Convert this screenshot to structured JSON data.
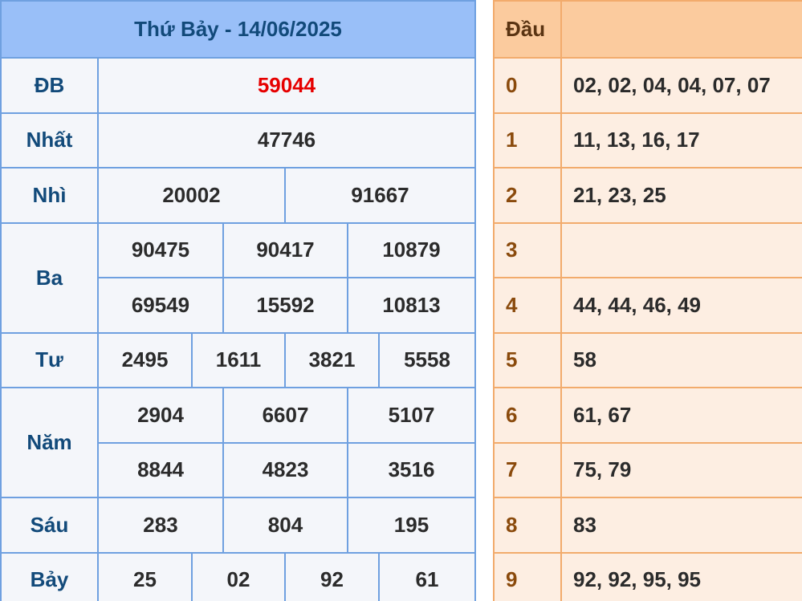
{
  "results": {
    "title": "Thứ Bảy - 14/06/2025",
    "db": {
      "label": "ĐB",
      "value": "59044",
      "color": "#e60000"
    },
    "nhat": {
      "label": "Nhất",
      "values": [
        "47746"
      ]
    },
    "nhi": {
      "label": "Nhì",
      "values": [
        "20002",
        "91667"
      ]
    },
    "ba": {
      "label": "Ba",
      "values": [
        "90475",
        "90417",
        "10879",
        "69549",
        "15592",
        "10813"
      ]
    },
    "tu": {
      "label": "Tư",
      "values": [
        "2495",
        "1611",
        "3821",
        "5558"
      ]
    },
    "nam": {
      "label": "Năm",
      "values": [
        "2904",
        "6607",
        "5107",
        "8844",
        "4823",
        "3516"
      ]
    },
    "sau": {
      "label": "Sáu",
      "values": [
        "283",
        "804",
        "195"
      ]
    },
    "bay": {
      "label": "Bảy",
      "values": [
        "25",
        "02",
        "92",
        "61"
      ]
    }
  },
  "loto": {
    "header": "Đầu",
    "rows": [
      {
        "dau": "0",
        "values": "02, 02, 04, 04, 07, 07"
      },
      {
        "dau": "1",
        "values": "11, 13, 16, 17"
      },
      {
        "dau": "2",
        "values": "21, 23, 25"
      },
      {
        "dau": "3",
        "values": ""
      },
      {
        "dau": "4",
        "values": "44, 44, 46, 49"
      },
      {
        "dau": "5",
        "values": "58"
      },
      {
        "dau": "6",
        "values": "61, 67"
      },
      {
        "dau": "7",
        "values": "75, 79"
      },
      {
        "dau": "8",
        "values": "83"
      },
      {
        "dau": "9",
        "values": "92, 92, 95, 95"
      }
    ]
  }
}
